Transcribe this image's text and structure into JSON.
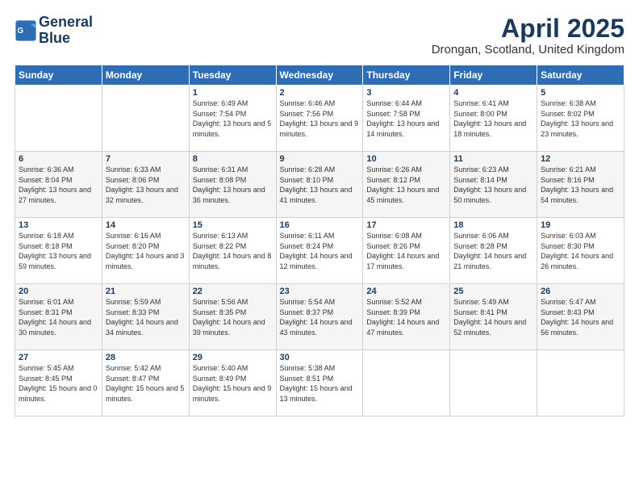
{
  "header": {
    "logo_line1": "General",
    "logo_line2": "Blue",
    "main_title": "April 2025",
    "subtitle": "Drongan, Scotland, United Kingdom"
  },
  "days_of_week": [
    "Sunday",
    "Monday",
    "Tuesday",
    "Wednesday",
    "Thursday",
    "Friday",
    "Saturday"
  ],
  "weeks": [
    [
      {
        "day": "",
        "info": ""
      },
      {
        "day": "",
        "info": ""
      },
      {
        "day": "1",
        "info": "Sunrise: 6:49 AM\nSunset: 7:54 PM\nDaylight: 13 hours and 5 minutes."
      },
      {
        "day": "2",
        "info": "Sunrise: 6:46 AM\nSunset: 7:56 PM\nDaylight: 13 hours and 9 minutes."
      },
      {
        "day": "3",
        "info": "Sunrise: 6:44 AM\nSunset: 7:58 PM\nDaylight: 13 hours and 14 minutes."
      },
      {
        "day": "4",
        "info": "Sunrise: 6:41 AM\nSunset: 8:00 PM\nDaylight: 13 hours and 18 minutes."
      },
      {
        "day": "5",
        "info": "Sunrise: 6:38 AM\nSunset: 8:02 PM\nDaylight: 13 hours and 23 minutes."
      }
    ],
    [
      {
        "day": "6",
        "info": "Sunrise: 6:36 AM\nSunset: 8:04 PM\nDaylight: 13 hours and 27 minutes."
      },
      {
        "day": "7",
        "info": "Sunrise: 6:33 AM\nSunset: 8:06 PM\nDaylight: 13 hours and 32 minutes."
      },
      {
        "day": "8",
        "info": "Sunrise: 6:31 AM\nSunset: 8:08 PM\nDaylight: 13 hours and 36 minutes."
      },
      {
        "day": "9",
        "info": "Sunrise: 6:28 AM\nSunset: 8:10 PM\nDaylight: 13 hours and 41 minutes."
      },
      {
        "day": "10",
        "info": "Sunrise: 6:26 AM\nSunset: 8:12 PM\nDaylight: 13 hours and 45 minutes."
      },
      {
        "day": "11",
        "info": "Sunrise: 6:23 AM\nSunset: 8:14 PM\nDaylight: 13 hours and 50 minutes."
      },
      {
        "day": "12",
        "info": "Sunrise: 6:21 AM\nSunset: 8:16 PM\nDaylight: 13 hours and 54 minutes."
      }
    ],
    [
      {
        "day": "13",
        "info": "Sunrise: 6:18 AM\nSunset: 8:18 PM\nDaylight: 13 hours and 59 minutes."
      },
      {
        "day": "14",
        "info": "Sunrise: 6:16 AM\nSunset: 8:20 PM\nDaylight: 14 hours and 3 minutes."
      },
      {
        "day": "15",
        "info": "Sunrise: 6:13 AM\nSunset: 8:22 PM\nDaylight: 14 hours and 8 minutes."
      },
      {
        "day": "16",
        "info": "Sunrise: 6:11 AM\nSunset: 8:24 PM\nDaylight: 14 hours and 12 minutes."
      },
      {
        "day": "17",
        "info": "Sunrise: 6:08 AM\nSunset: 8:26 PM\nDaylight: 14 hours and 17 minutes."
      },
      {
        "day": "18",
        "info": "Sunrise: 6:06 AM\nSunset: 8:28 PM\nDaylight: 14 hours and 21 minutes."
      },
      {
        "day": "19",
        "info": "Sunrise: 6:03 AM\nSunset: 8:30 PM\nDaylight: 14 hours and 26 minutes."
      }
    ],
    [
      {
        "day": "20",
        "info": "Sunrise: 6:01 AM\nSunset: 8:31 PM\nDaylight: 14 hours and 30 minutes."
      },
      {
        "day": "21",
        "info": "Sunrise: 5:59 AM\nSunset: 8:33 PM\nDaylight: 14 hours and 34 minutes."
      },
      {
        "day": "22",
        "info": "Sunrise: 5:56 AM\nSunset: 8:35 PM\nDaylight: 14 hours and 39 minutes."
      },
      {
        "day": "23",
        "info": "Sunrise: 5:54 AM\nSunset: 8:37 PM\nDaylight: 14 hours and 43 minutes."
      },
      {
        "day": "24",
        "info": "Sunrise: 5:52 AM\nSunset: 8:39 PM\nDaylight: 14 hours and 47 minutes."
      },
      {
        "day": "25",
        "info": "Sunrise: 5:49 AM\nSunset: 8:41 PM\nDaylight: 14 hours and 52 minutes."
      },
      {
        "day": "26",
        "info": "Sunrise: 5:47 AM\nSunset: 8:43 PM\nDaylight: 14 hours and 56 minutes."
      }
    ],
    [
      {
        "day": "27",
        "info": "Sunrise: 5:45 AM\nSunset: 8:45 PM\nDaylight: 15 hours and 0 minutes."
      },
      {
        "day": "28",
        "info": "Sunrise: 5:42 AM\nSunset: 8:47 PM\nDaylight: 15 hours and 5 minutes."
      },
      {
        "day": "29",
        "info": "Sunrise: 5:40 AM\nSunset: 8:49 PM\nDaylight: 15 hours and 9 minutes."
      },
      {
        "day": "30",
        "info": "Sunrise: 5:38 AM\nSunset: 8:51 PM\nDaylight: 15 hours and 13 minutes."
      },
      {
        "day": "",
        "info": ""
      },
      {
        "day": "",
        "info": ""
      },
      {
        "day": "",
        "info": ""
      }
    ]
  ]
}
